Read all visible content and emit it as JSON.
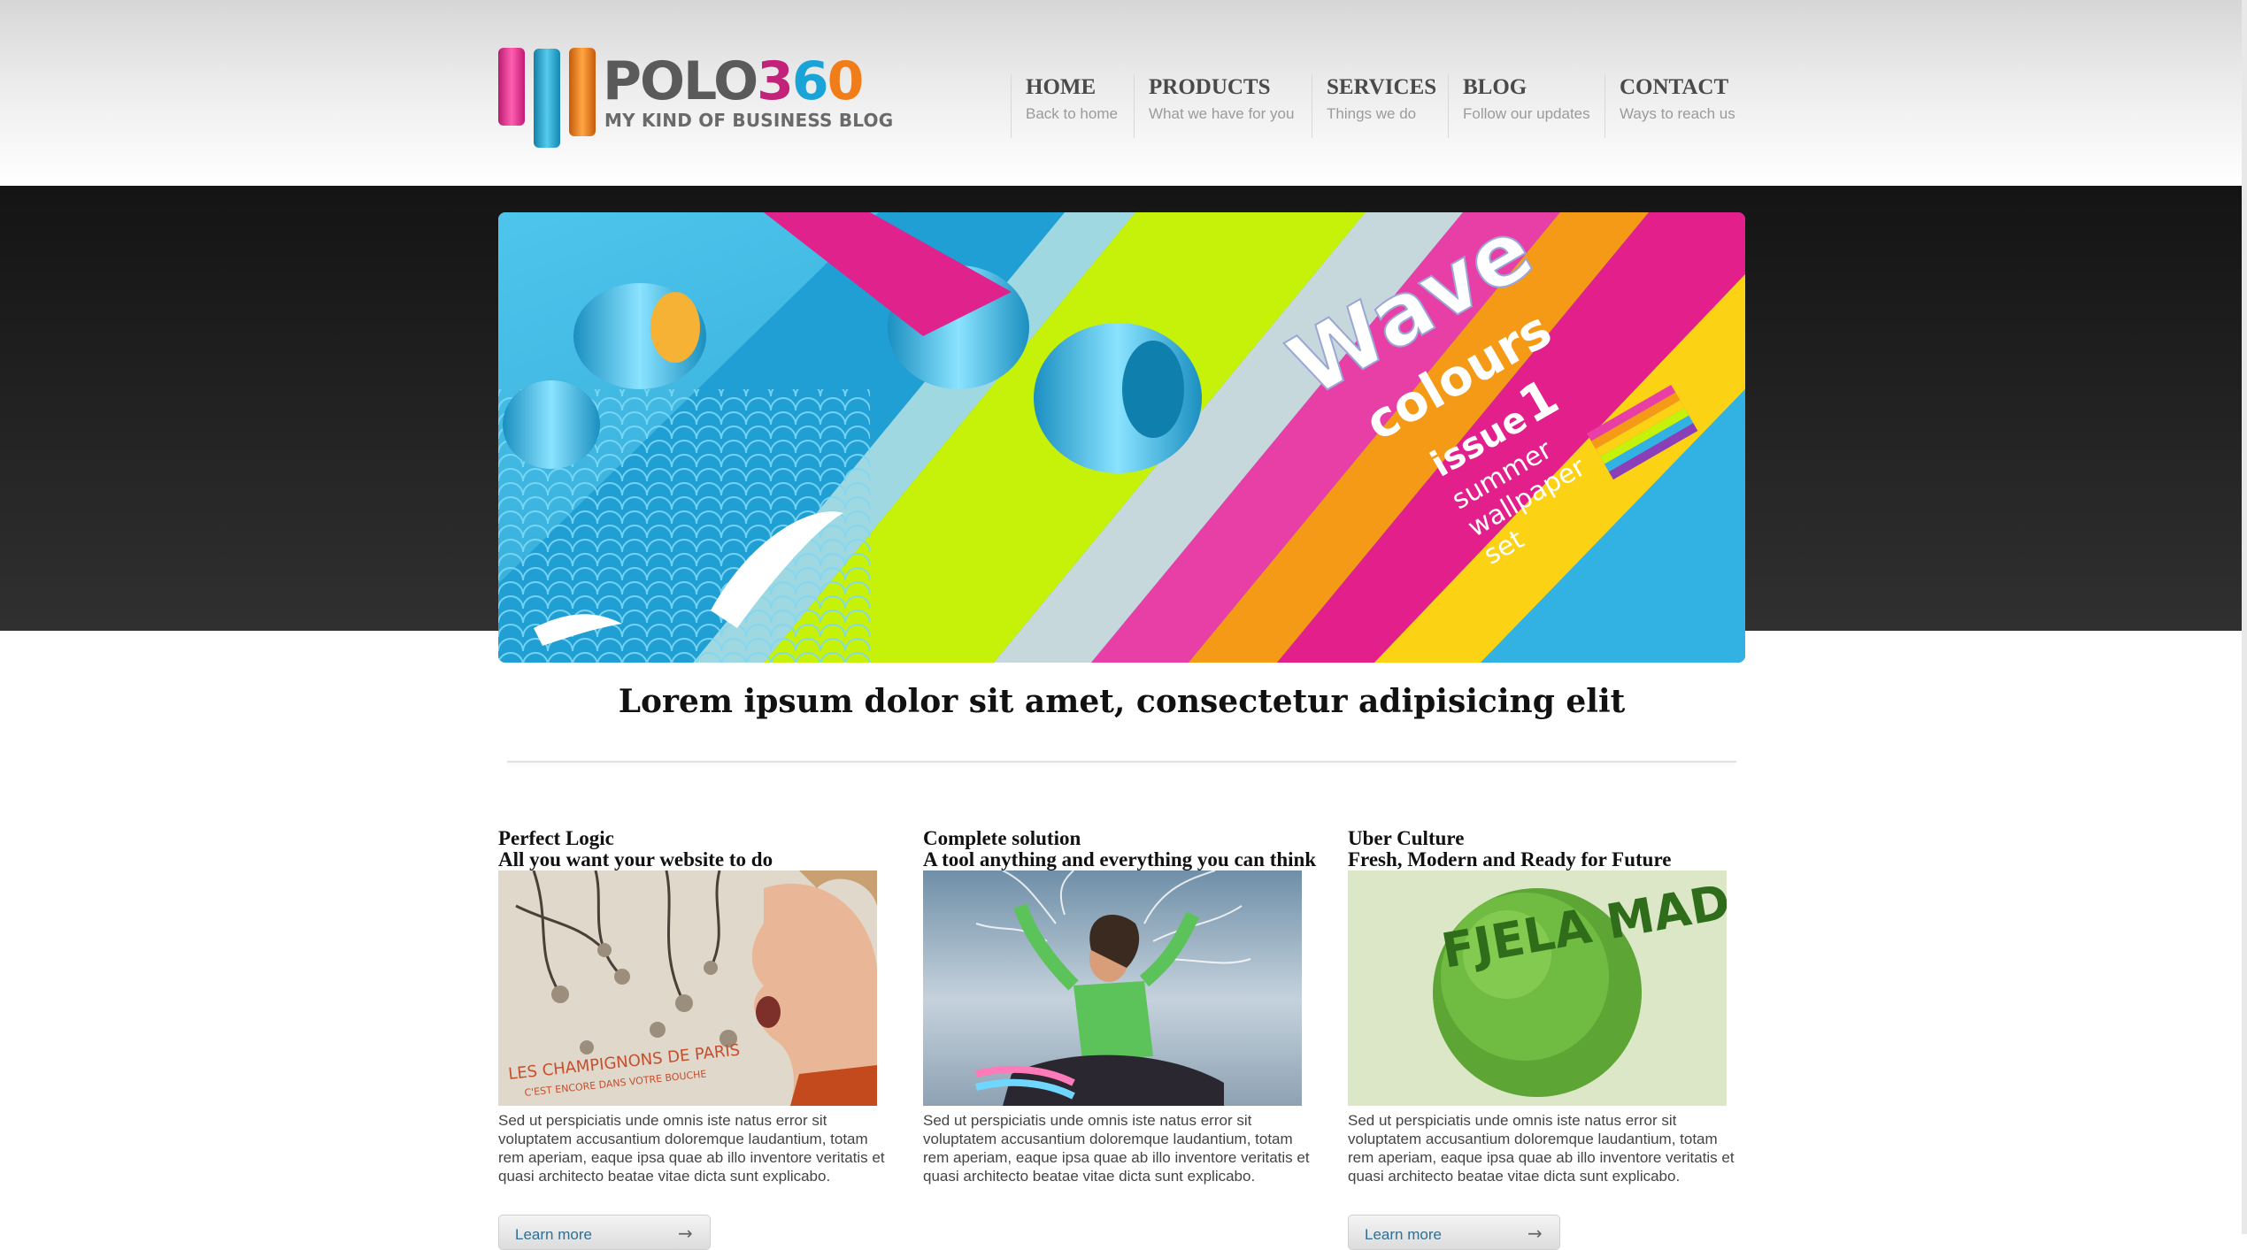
{
  "header": {
    "logo": {
      "wordmark_parts": [
        "POLO",
        "3",
        "6",
        "0"
      ],
      "tagline": "MY KIND OF BUSINESS BLOG"
    },
    "nav": [
      {
        "label": "HOME",
        "sub": "Back to home"
      },
      {
        "label": "PRODUCTS",
        "sub": "What we have for you"
      },
      {
        "label": "SERVICES",
        "sub": "Things we do"
      },
      {
        "label": "BLOG",
        "sub": "Follow our updates"
      },
      {
        "label": "CONTACT",
        "sub": "Ways to reach us"
      }
    ]
  },
  "banner": {
    "title": "Wave",
    "subtitle": "colours",
    "issue": "issue",
    "issue_num": "1",
    "line1": "summer",
    "line2": "wallpaper",
    "line3": "set"
  },
  "main": {
    "headline": "Lorem ipsum dolor sit amet, consectetur adipisicing elit",
    "columns": [
      {
        "title": "Perfect Logic",
        "subtitle": "All you want your website to do",
        "image_caption_1": "LES CHAMPIGNONS DE PARIS",
        "image_caption_2": "C'EST ENCORE DANS VOTRE BOUCHE",
        "body": "Sed ut perspiciatis unde omnis iste natus error sit voluptatem accusantium doloremque laudantium, totam rem aperiam, eaque ipsa quae ab illo inventore veritatis et quasi architecto beatae vitae dicta sunt explicabo.",
        "button": "Learn more"
      },
      {
        "title": "Complete solution",
        "subtitle": "A tool anything and everything you can think",
        "body": "Sed ut perspiciatis unde omnis iste natus error sit voluptatem accusantium doloremque laudantium, totam rem aperiam, eaque ipsa quae ab illo inventore veritatis et quasi architecto beatae vitae dicta sunt explicabo."
      },
      {
        "title": "Uber Culture",
        "subtitle": "Fresh, Modern and Ready for Future",
        "image_text": "FJELA MADERA",
        "body": "Sed ut perspiciatis unde omnis iste natus error sit voluptatem accusantium doloremque laudantium, totam rem aperiam, eaque ipsa quae ab illo inventore veritatis et quasi architecto beatae vitae dicta sunt explicabo.",
        "button": "Learn more"
      }
    ]
  },
  "colors": {
    "brand_pink": "#c2227a",
    "brand_blue": "#1aa3d6",
    "brand_orange": "#f07d1a",
    "dark_band": "#1e1e1e",
    "link": "#2f6f93"
  },
  "icons": {
    "button_arrow": "arrow-right-icon"
  }
}
